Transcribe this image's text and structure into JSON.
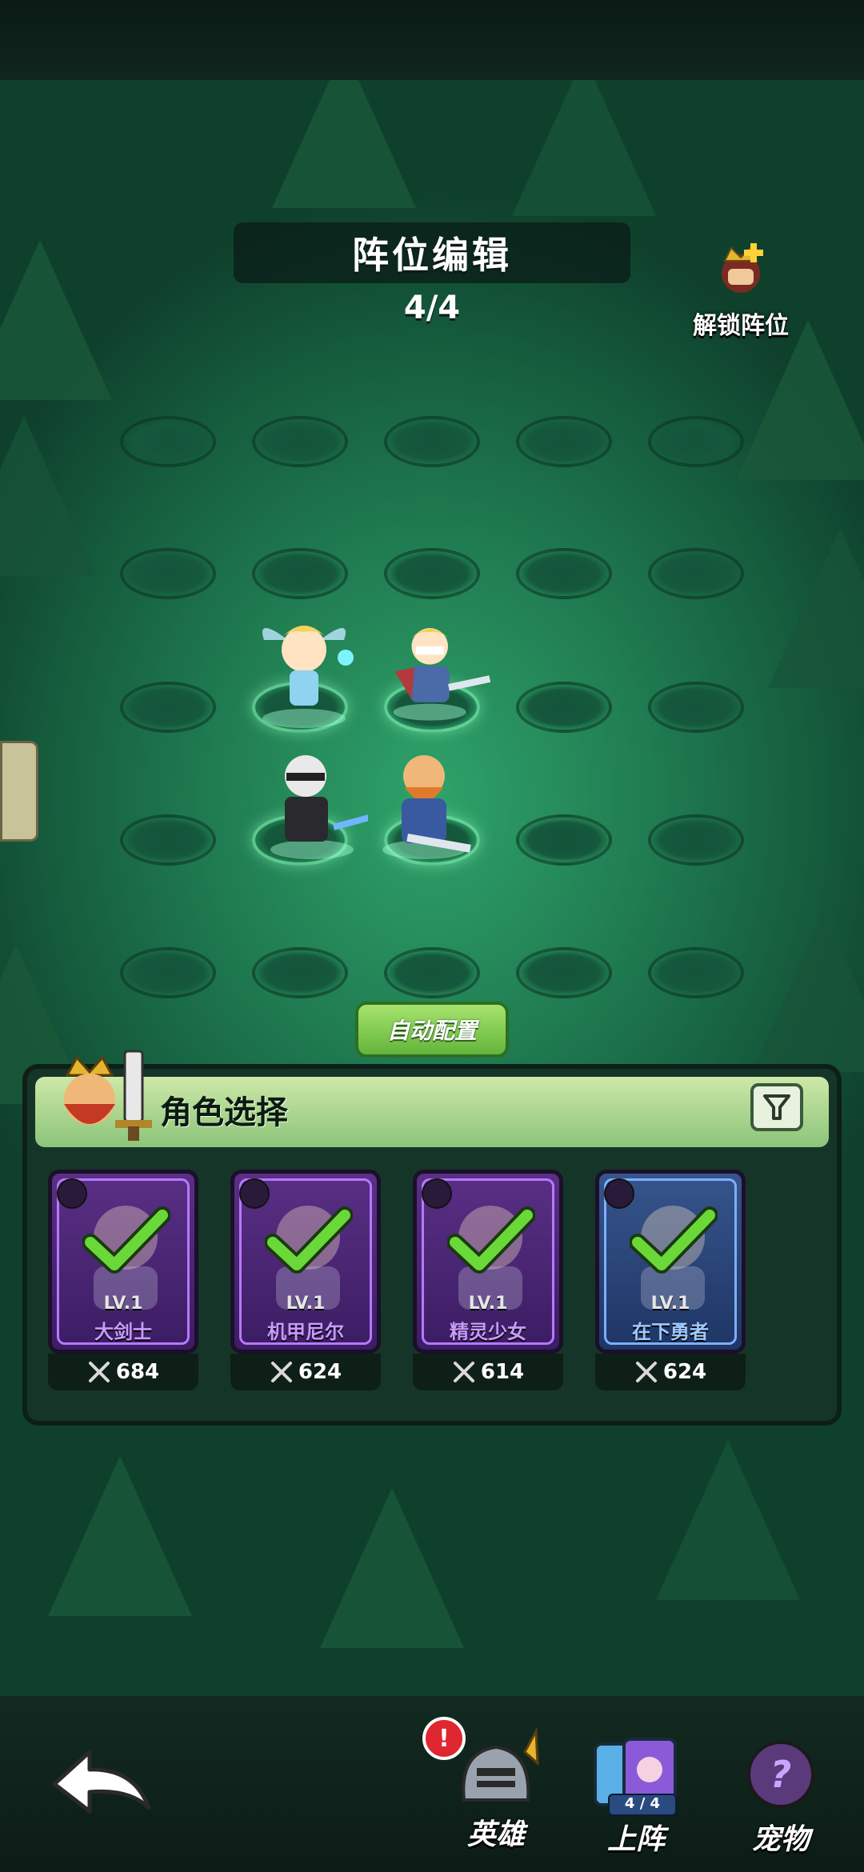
{
  "header": {
    "title": "阵位编辑",
    "counter": "4/4",
    "unlock_label": "解锁阵位"
  },
  "auto_button": "自动配置",
  "panel": {
    "title": "角色选择"
  },
  "cards": [
    {
      "level": "LV.1",
      "name": "大剑士",
      "power": "684",
      "rarity_color": "#b678ff",
      "role_icon": "strength-icon"
    },
    {
      "level": "LV.1",
      "name": "机甲尼尔",
      "power": "624",
      "rarity_color": "#b678ff",
      "role_icon": "agility-icon"
    },
    {
      "level": "LV.1",
      "name": "精灵少女",
      "power": "614",
      "rarity_color": "#b678ff",
      "role_icon": "lightning-icon"
    },
    {
      "level": "LV.1",
      "name": "在下勇者",
      "power": "624",
      "rarity_color": "#7ab0ff",
      "role_icon": "strength-icon"
    }
  ],
  "nav": {
    "heroes": "英雄",
    "heroes_badge": "!",
    "deploy": "上阵",
    "deploy_count": "4 / 4",
    "pets": "宠物"
  }
}
